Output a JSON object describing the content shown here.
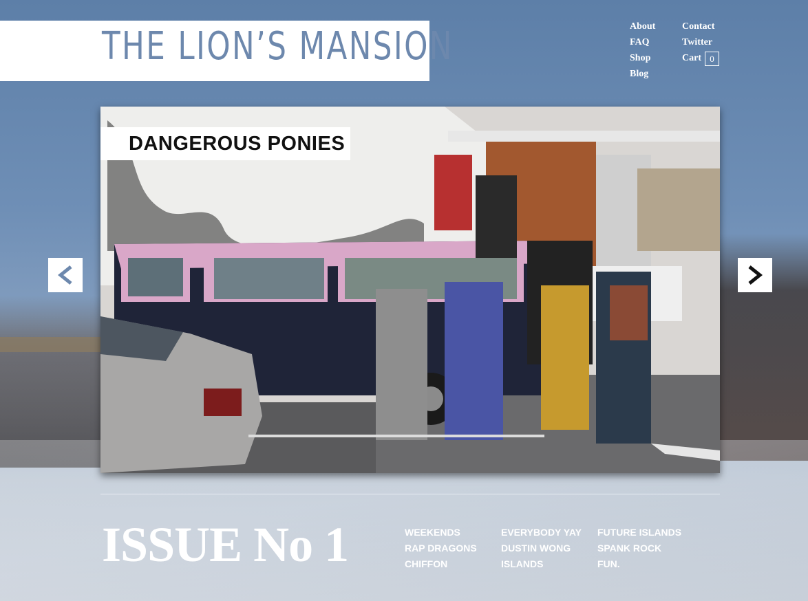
{
  "header": {
    "logo": "THE LION’S MANSION"
  },
  "nav": {
    "about": "About",
    "faq": "FAQ",
    "shop": "Shop",
    "blog": "Blog",
    "contact": "Contact",
    "twitter": "Twitter",
    "cart": "Cart",
    "cart_count": "0"
  },
  "slider": {
    "title": "DANGEROUS PONIES",
    "prev_icon": "chevron-left-icon",
    "next_icon": "chevron-right-icon"
  },
  "issue": {
    "title": "ISSUE No 1"
  },
  "bands": [
    [
      "WEEKENDS",
      "RAP DRAGONS",
      "CHIFFON"
    ],
    [
      "EVERYBODY YAY",
      "DUSTIN WONG",
      "ISLANDS"
    ],
    [
      "FUTURE ISLANDS",
      "SPANK ROCK",
      "FUN."
    ]
  ],
  "colors": {
    "logo": "#6d88ad",
    "background": "#6f8fb6",
    "text_light": "#ffffff"
  }
}
